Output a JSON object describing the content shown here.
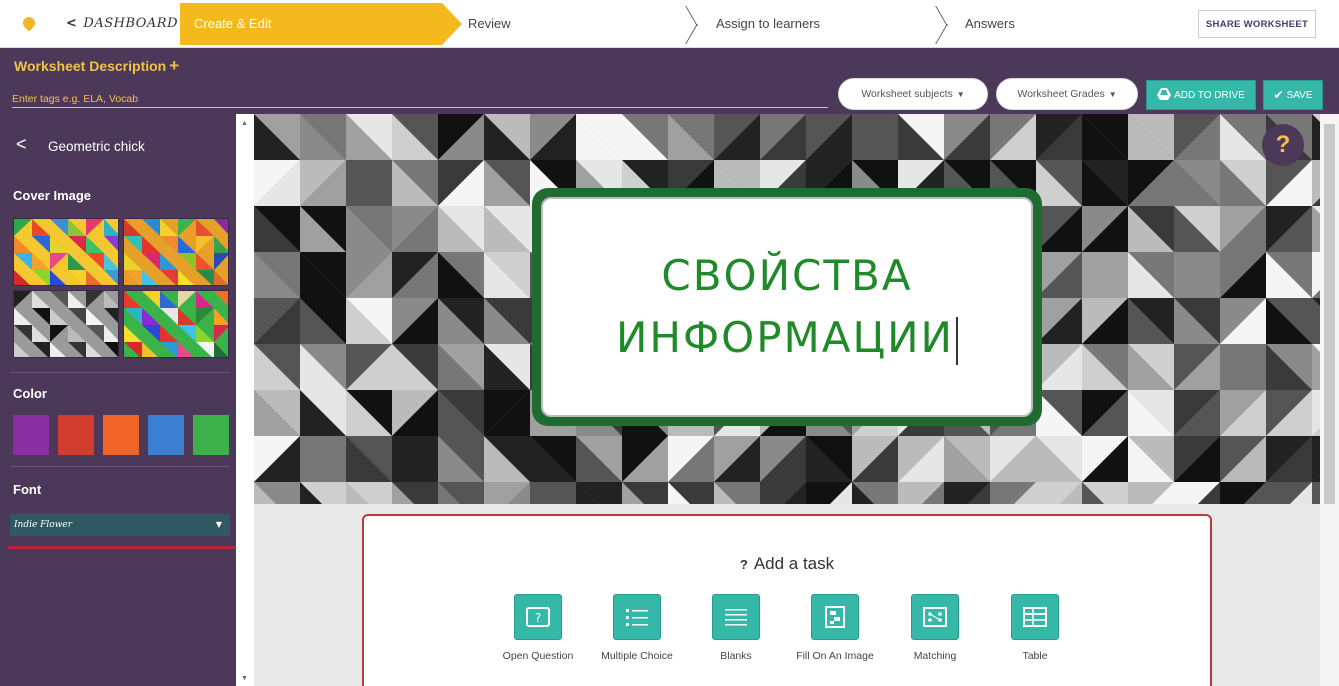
{
  "nav": {
    "dashboard_label": "DASHBOARD",
    "steps": [
      "Create & Edit",
      "Review",
      "Assign to learners",
      "Answers"
    ],
    "share_label": "SHARE WORKSHEET"
  },
  "header": {
    "description_label": "Worksheet Description",
    "plus": "+",
    "tags_placeholder": "Enter tags e.g. ELA, Vocab",
    "subjects_label": "Worksheet subjects",
    "grades_label": "Worksheet Grades",
    "add_to_drive_label": "ADD TO DRIVE",
    "save_label": "SAVE"
  },
  "sidebar": {
    "theme_name": "Geometric chick",
    "cover_image_label": "Cover Image",
    "color_label": "Color",
    "font_label": "Font",
    "font_value": "Indie Flower",
    "colors": [
      "#8a2fa0",
      "#d23c2c",
      "#f06428",
      "#3a7fd0",
      "#3cb14a"
    ]
  },
  "cover": {
    "title_line1": "СВОЙСТВА",
    "title_line2": "ИНФОРМАЦИИ",
    "help": "?"
  },
  "tasks": {
    "heading_icon": "?",
    "heading": "Add a task",
    "items": [
      {
        "label": "Open Question",
        "icon": "question-box-icon"
      },
      {
        "label": "Multiple Choice",
        "icon": "list-icon"
      },
      {
        "label": "Blanks",
        "icon": "lines-icon"
      },
      {
        "label": "Fill On An Image",
        "icon": "image-pin-icon"
      },
      {
        "label": "Matching",
        "icon": "matching-icon"
      },
      {
        "label": "Table",
        "icon": "table-icon"
      }
    ]
  }
}
